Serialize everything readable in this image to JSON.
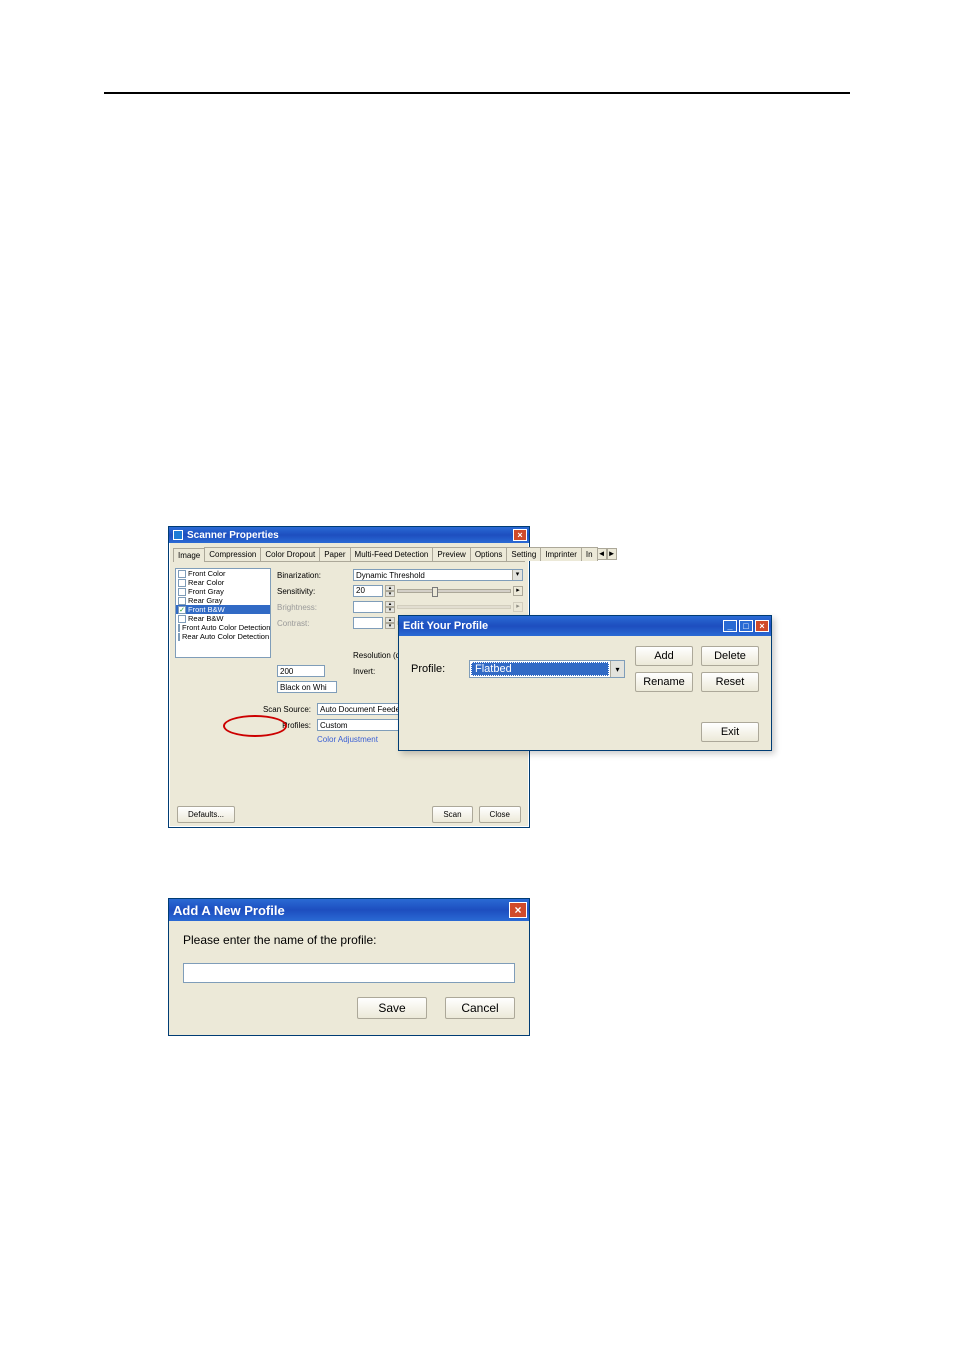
{
  "scanner": {
    "title": "Scanner Properties",
    "tabs": [
      "Image",
      "Compression",
      "Color Dropout",
      "Paper",
      "Multi-Feed Detection",
      "Preview",
      "Options",
      "Setting",
      "Imprinter",
      "In"
    ],
    "active_tab": 0,
    "image_list": [
      {
        "label": "Front Color",
        "checked": false,
        "selected": false
      },
      {
        "label": "Rear Color",
        "checked": false,
        "selected": false
      },
      {
        "label": "Front Gray",
        "checked": false,
        "selected": false
      },
      {
        "label": "Rear Gray",
        "checked": false,
        "selected": false
      },
      {
        "label": "Front B&W",
        "checked": true,
        "selected": true
      },
      {
        "label": "Rear B&W",
        "checked": false,
        "selected": false
      },
      {
        "label": "Front Auto Color Detection",
        "checked": false,
        "selected": false
      },
      {
        "label": "Rear Auto Color Detection",
        "checked": false,
        "selected": false
      }
    ],
    "fields": {
      "binarization_label": "Binarization:",
      "binarization_value": "Dynamic Threshold",
      "sensitivity_label": "Sensitivity:",
      "sensitivity_value": "20",
      "brightness_label": "Brightness:",
      "contrast_label": "Contrast:",
      "resolution_label": "Resolution (dpi):",
      "resolution_value": "200",
      "invert_label": "Invert:",
      "invert_value": "Black on Whi"
    },
    "scan_source_label": "Scan Source:",
    "scan_source_value": "Auto Document Feeder",
    "profiles_label": "Profiles:",
    "profiles_value": "Custom",
    "color_adjustment": "Color Adjustment",
    "defaults_btn": "Defaults...",
    "scan_btn": "Scan",
    "close_btn": "Close"
  },
  "edit_profile": {
    "title": "Edit Your Profile",
    "profile_label": "Profile:",
    "profile_value": "Flatbed",
    "add_btn": "Add",
    "delete_btn": "Delete",
    "rename_btn": "Rename",
    "reset_btn": "Reset",
    "exit_btn": "Exit"
  },
  "add_profile": {
    "title": "Add A New Profile",
    "prompt": "Please enter the name of the profile:",
    "input_value": "",
    "save_btn": "Save",
    "cancel_btn": "Cancel"
  }
}
